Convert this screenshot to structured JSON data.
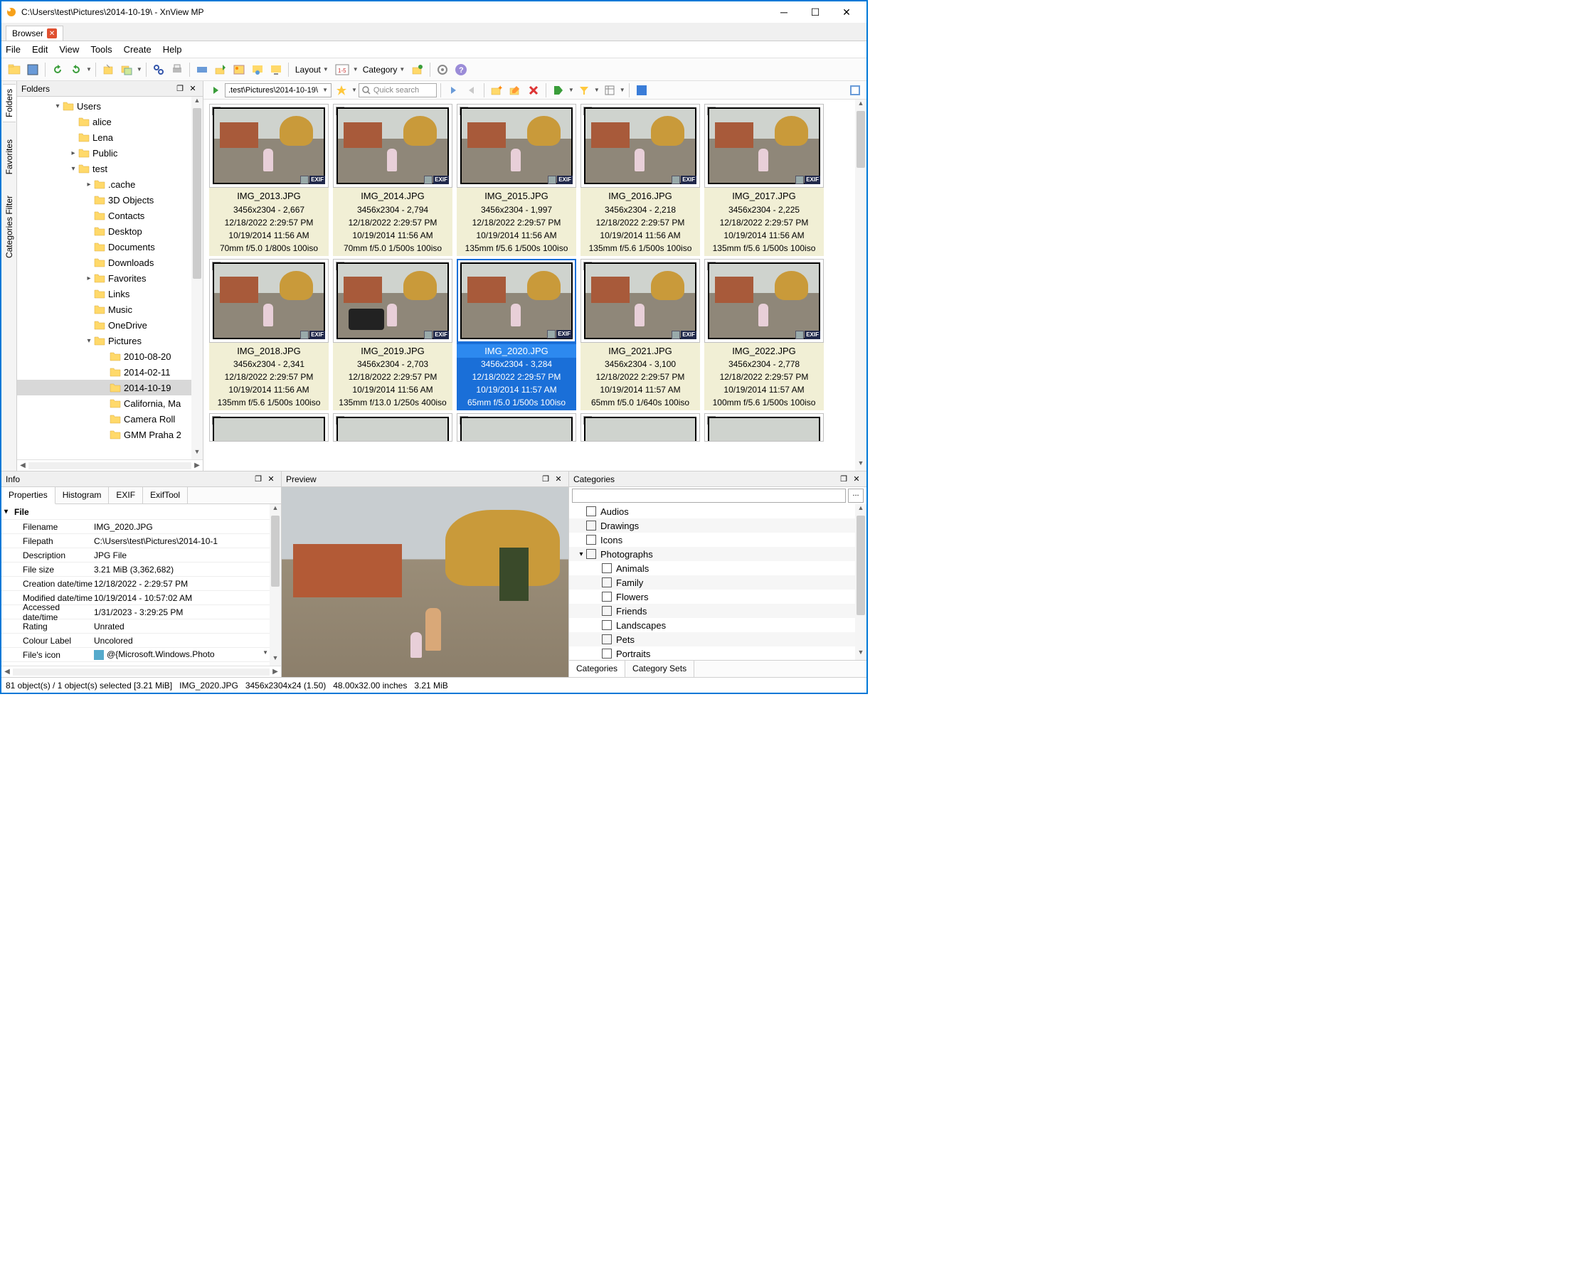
{
  "window": {
    "title": "C:\\Users\\test\\Pictures\\2014-10-19\\ - XnView MP"
  },
  "tabs": {
    "browser": "Browser"
  },
  "menu": [
    "File",
    "Edit",
    "View",
    "Tools",
    "Create",
    "Help"
  ],
  "toolbar": {
    "layout": "Layout",
    "category": "Category"
  },
  "sidetabs": [
    "Folders",
    "Favorites",
    "Categories Filter"
  ],
  "folders_panel": {
    "title": "Folders"
  },
  "tree": [
    {
      "depth": 0,
      "exp": "v",
      "icon": "folder",
      "label": "Users"
    },
    {
      "depth": 1,
      "exp": "",
      "icon": "folder",
      "label": "alice"
    },
    {
      "depth": 1,
      "exp": "",
      "icon": "folder",
      "label": "Lena"
    },
    {
      "depth": 1,
      "exp": ">",
      "icon": "folder",
      "label": "Public"
    },
    {
      "depth": 1,
      "exp": "v",
      "icon": "folder",
      "label": "test"
    },
    {
      "depth": 2,
      "exp": ">",
      "icon": "folder",
      "label": ".cache"
    },
    {
      "depth": 2,
      "exp": "",
      "icon": "cube",
      "label": "3D Objects"
    },
    {
      "depth": 2,
      "exp": "",
      "icon": "contacts",
      "label": "Contacts"
    },
    {
      "depth": 2,
      "exp": "",
      "icon": "desktop",
      "label": "Desktop"
    },
    {
      "depth": 2,
      "exp": "",
      "icon": "docs",
      "label": "Documents"
    },
    {
      "depth": 2,
      "exp": "",
      "icon": "down",
      "label": "Downloads"
    },
    {
      "depth": 2,
      "exp": ">",
      "icon": "star",
      "label": "Favorites"
    },
    {
      "depth": 2,
      "exp": "",
      "icon": "links",
      "label": "Links"
    },
    {
      "depth": 2,
      "exp": "",
      "icon": "music",
      "label": "Music"
    },
    {
      "depth": 2,
      "exp": "",
      "icon": "cloud",
      "label": "OneDrive"
    },
    {
      "depth": 2,
      "exp": "v",
      "icon": "pics",
      "label": "Pictures"
    },
    {
      "depth": 3,
      "exp": "",
      "icon": "folder",
      "label": "2010-08-20"
    },
    {
      "depth": 3,
      "exp": "",
      "icon": "folder",
      "label": "2014-02-11"
    },
    {
      "depth": 3,
      "exp": "",
      "icon": "folder",
      "label": "2014-10-19",
      "selected": true
    },
    {
      "depth": 3,
      "exp": "",
      "icon": "folder",
      "label": "California, Ma"
    },
    {
      "depth": 3,
      "exp": "",
      "icon": "folder",
      "label": "Camera Roll"
    },
    {
      "depth": 3,
      "exp": "",
      "icon": "folder",
      "label": "GMM Praha 2"
    }
  ],
  "browserbar": {
    "path": ".test\\Pictures\\2014-10-19\\",
    "search_placeholder": "Quick search"
  },
  "thumbs": [
    {
      "name": "IMG_2013.JPG",
      "dim": "3456x2304 - 2,667",
      "mod": "12/18/2022 2:29:57 PM",
      "taken": "10/19/2014 11:56 AM",
      "exif": "70mm f/5.0 1/800s 100iso"
    },
    {
      "name": "IMG_2014.JPG",
      "dim": "3456x2304 - 2,794",
      "mod": "12/18/2022 2:29:57 PM",
      "taken": "10/19/2014 11:56 AM",
      "exif": "70mm f/5.0 1/500s 100iso"
    },
    {
      "name": "IMG_2015.JPG",
      "dim": "3456x2304 - 1,997",
      "mod": "12/18/2022 2:29:57 PM",
      "taken": "10/19/2014 11:56 AM",
      "exif": "135mm f/5.6 1/500s 100iso"
    },
    {
      "name": "IMG_2016.JPG",
      "dim": "3456x2304 - 2,218",
      "mod": "12/18/2022 2:29:57 PM",
      "taken": "10/19/2014 11:56 AM",
      "exif": "135mm f/5.6 1/500s 100iso"
    },
    {
      "name": "IMG_2017.JPG",
      "dim": "3456x2304 - 2,225",
      "mod": "12/18/2022 2:29:57 PM",
      "taken": "10/19/2014 11:56 AM",
      "exif": "135mm f/5.6 1/500s 100iso"
    },
    {
      "name": "IMG_2018.JPG",
      "dim": "3456x2304 - 2,341",
      "mod": "12/18/2022 2:29:57 PM",
      "taken": "10/19/2014 11:56 AM",
      "exif": "135mm f/5.6 1/500s 100iso"
    },
    {
      "name": "IMG_2019.JPG",
      "dim": "3456x2304 - 2,703",
      "mod": "12/18/2022 2:29:57 PM",
      "taken": "10/19/2014 11:56 AM",
      "exif": "135mm f/13.0 1/250s 400iso"
    },
    {
      "name": "IMG_2020.JPG",
      "dim": "3456x2304 - 3,284",
      "mod": "12/18/2022 2:29:57 PM",
      "taken": "10/19/2014 11:57 AM",
      "exif": "65mm f/5.0 1/500s 100iso",
      "selected": true
    },
    {
      "name": "IMG_2021.JPG",
      "dim": "3456x2304 - 3,100",
      "mod": "12/18/2022 2:29:57 PM",
      "taken": "10/19/2014 11:57 AM",
      "exif": "65mm f/5.0 1/640s 100iso"
    },
    {
      "name": "IMG_2022.JPG",
      "dim": "3456x2304 - 2,778",
      "mod": "12/18/2022 2:29:57 PM",
      "taken": "10/19/2014 11:57 AM",
      "exif": "100mm f/5.6 1/500s 100iso"
    }
  ],
  "exif_badge": "EXIF",
  "info_panel": {
    "title": "Info"
  },
  "info_tabs": [
    "Properties",
    "Histogram",
    "EXIF",
    "ExifTool"
  ],
  "props_group": "File",
  "props": [
    {
      "k": "Filename",
      "v": "IMG_2020.JPG"
    },
    {
      "k": "Filepath",
      "v": "C:\\Users\\test\\Pictures\\2014-10-1"
    },
    {
      "k": "Description",
      "v": "JPG File"
    },
    {
      "k": "File size",
      "v": "3.21 MiB (3,362,682)"
    },
    {
      "k": "Creation date/time",
      "v": "12/18/2022 - 2:29:57 PM"
    },
    {
      "k": "Modified date/time",
      "v": "10/19/2014 - 10:57:02 AM"
    },
    {
      "k": "Accessed date/time",
      "v": "1/31/2023 - 3:29:25 PM"
    },
    {
      "k": "Rating",
      "v": "Unrated"
    },
    {
      "k": "Colour Label",
      "v": "Uncolored"
    },
    {
      "k": "File's icon",
      "v": "@{Microsoft.Windows.Photo"
    }
  ],
  "preview_panel": {
    "title": "Preview"
  },
  "categories_panel": {
    "title": "Categories"
  },
  "cat_more": "...",
  "categories": [
    {
      "depth": 0,
      "exp": "",
      "label": "Audios"
    },
    {
      "depth": 0,
      "exp": "",
      "label": "Drawings"
    },
    {
      "depth": 0,
      "exp": "",
      "label": "Icons"
    },
    {
      "depth": 0,
      "exp": "v",
      "label": "Photographs"
    },
    {
      "depth": 1,
      "exp": "",
      "label": "Animals"
    },
    {
      "depth": 1,
      "exp": "",
      "label": "Family"
    },
    {
      "depth": 1,
      "exp": "",
      "label": "Flowers"
    },
    {
      "depth": 1,
      "exp": "",
      "label": "Friends"
    },
    {
      "depth": 1,
      "exp": "",
      "label": "Landscapes"
    },
    {
      "depth": 1,
      "exp": "",
      "label": "Pets"
    },
    {
      "depth": 1,
      "exp": "",
      "label": "Portraits"
    }
  ],
  "cat_tabs": [
    "Categories",
    "Category Sets"
  ],
  "status": {
    "objects": "81 object(s) / 1 object(s) selected [3.21 MiB]",
    "file": "IMG_2020.JPG",
    "dims": "3456x2304x24 (1.50)",
    "inches": "48.00x32.00 inches",
    "size": "3.21 MiB"
  }
}
